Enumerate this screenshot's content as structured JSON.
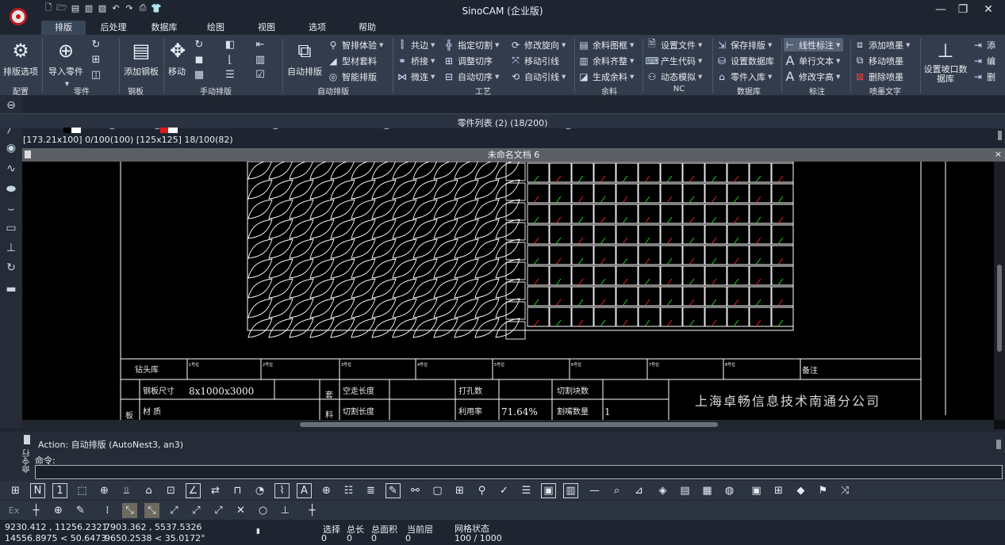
{
  "title": "SinoCAM (企业版)",
  "tabs": [
    "排版",
    "后处理",
    "数据库",
    "绘图",
    "视图",
    "选项",
    "帮助"
  ],
  "groups": {
    "config": "配置",
    "parts": "零件",
    "plate": "钢板",
    "manual": "手动排版",
    "auto": "自动排版",
    "craft": "工艺",
    "remnant": "余料",
    "nc": "NC",
    "db": "数据库",
    "annot": "标注",
    "spray": "喷墨文字"
  },
  "buttons": {
    "nest_opt": "排版选项",
    "import_parts": "导入零件",
    "add_plate": "添加钢板",
    "move": "移动",
    "auto_nest": "自动排版",
    "bevel": "设置坡口数据库"
  },
  "small": {
    "smart_exp": "智排体验",
    "profile": "型材套料",
    "smart_nest": "智能排版",
    "common_edge": "共边",
    "bridge": "桥接",
    "micro": "微连",
    "specify_cut": "指定切割",
    "adjust_order": "调整切序",
    "auto_order": "自动切序",
    "modify_rot": "修改旋向",
    "move_lead": "移动引线",
    "auto_lead": "自动引线",
    "remnant_frame": "余料图框",
    "remnant_align": "余料齐整",
    "gen_remnant": "生成余料",
    "set_file": "设置文件",
    "gen_code": "产生代码",
    "dyn_sim": "动态模拟",
    "save_nest": "保存排版",
    "set_db": "设置数据库",
    "part_db": "零件入库",
    "linear_dim": "线性标注",
    "single_text": "单行文本",
    "modify_height": "修改字高",
    "add_spray": "添加喷墨",
    "move_spray": "移动喷墨",
    "del_spray": "删除喷墨",
    "add_trunc": "添",
    "edit_trunc": "编",
    "del_trunc": "删"
  },
  "parts_list": {
    "title": "零件列表 (2) (18/200)",
    "info": "[173.21x100] 0/100(100) [125x125] 18/100(82)"
  },
  "document": {
    "title": "未命名文档 6"
  },
  "titleblock": {
    "drill_lib": "钻头库",
    "remarks": "备注",
    "nums": [
      "1号位",
      "2号位",
      "3号位",
      "4号位",
      "5号位",
      "6号位",
      "7号位",
      "8号位"
    ],
    "plate_size_lbl": "钢板尺寸",
    "plate_size": "8x1000x3000",
    "material_lbl": "材 质",
    "board": "板",
    "nest_col": "套",
    "nest_col2": "料",
    "idle_len": "空走长度",
    "cut_len": "切割长度",
    "drill_count": "打孔数",
    "util_lbl": "利用率",
    "util": "71.64%",
    "cut_blocks": "切割块数",
    "nozzle": "割嘴数量",
    "nozzle_val": "1",
    "company": "上海卓畅信息技术南通分公司"
  },
  "command": {
    "action": "Action: 自动排版 (AutoNest3, an3)",
    "prompt": "命令:",
    "side": "命令行"
  },
  "status": {
    "coords": [
      "9230.412 , 11256.2321",
      "14556.8975 < 50.6473"
    ],
    "coords2": [
      "7903.362 , 5537.5326",
      "9650.2538 < 35.0172°"
    ],
    "select_lbl": "选择",
    "select": "0",
    "length_lbl": "总长",
    "length": "0",
    "area_lbl": "总面积",
    "area": "0",
    "layer_lbl": "当前层",
    "layer": "0",
    "grid_lbl": "网格状态",
    "grid": "100 / 1000"
  },
  "colors": {
    "ribbon": "#333c4c",
    "canvas": "#000000",
    "accent_red": "#c0191f",
    "part_line": "#ffffff",
    "lead_green": "#22dd22",
    "lead_red": "#ff2222"
  },
  "icons": [
    "logo-icon",
    "gear-icon",
    "plus-circle-icon",
    "move-icon",
    "grid-icon",
    "stamp-icon",
    "folder-icon",
    "db-icon"
  ]
}
